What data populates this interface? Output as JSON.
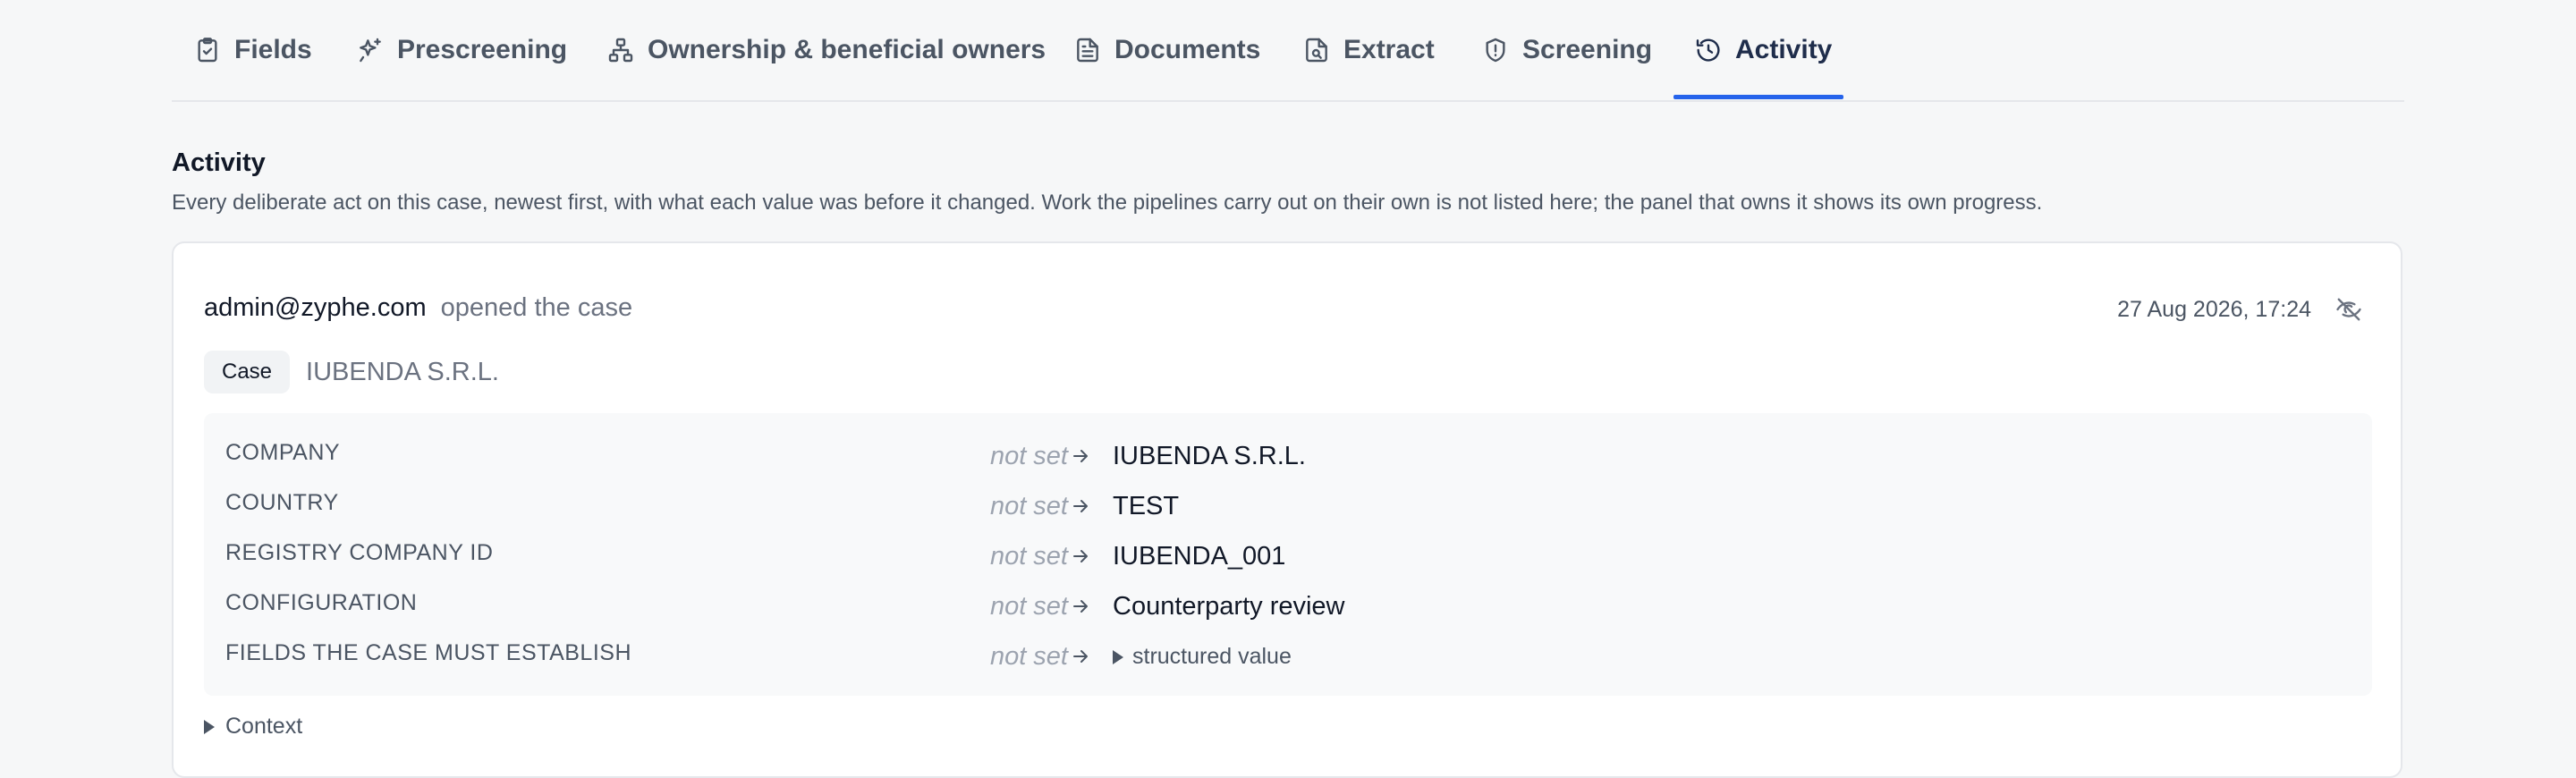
{
  "tabs": [
    {
      "label": "Fields",
      "icon": "clipboard-check-icon"
    },
    {
      "label": "Prescreening",
      "icon": "sparkles-icon"
    },
    {
      "label": "Ownership & beneficial owners",
      "icon": "hierarchy-icon"
    },
    {
      "label": "Documents",
      "icon": "document-icon"
    },
    {
      "label": "Extract",
      "icon": "file-search-icon"
    },
    {
      "label": "Screening",
      "icon": "shield-icon"
    },
    {
      "label": "Activity",
      "icon": "history-icon",
      "active": true
    }
  ],
  "section": {
    "title": "Activity",
    "description": "Every deliberate act on this case, newest first, with what each value was before it changed. Work the pipelines carry out on their own is not listed here; the panel that owns it shows its own progress."
  },
  "event": {
    "actor": "admin@zyphe.com",
    "verb": "opened the case",
    "timestamp": "27 Aug 2026, 17:24",
    "entity_type": "Case",
    "entity_name": "IUBENDA S.R.L.",
    "changes": [
      {
        "field": "COMPANY",
        "old": "not set",
        "new": "IUBENDA S.R.L."
      },
      {
        "field": "COUNTRY",
        "old": "not set",
        "new": "TEST"
      },
      {
        "field": "REGISTRY COMPANY ID",
        "old": "not set",
        "new": "IUBENDA_001"
      },
      {
        "field": "CONFIGURATION",
        "old": "not set",
        "new": "Counterparty review"
      },
      {
        "field": "FIELDS THE CASE MUST ESTABLISH",
        "old": "not set",
        "new": "structured value",
        "structured": true
      }
    ],
    "context_label": "Context"
  },
  "colors": {
    "accent": "#2563eb",
    "background": "#f6f7f8",
    "card": "#ffffff"
  }
}
